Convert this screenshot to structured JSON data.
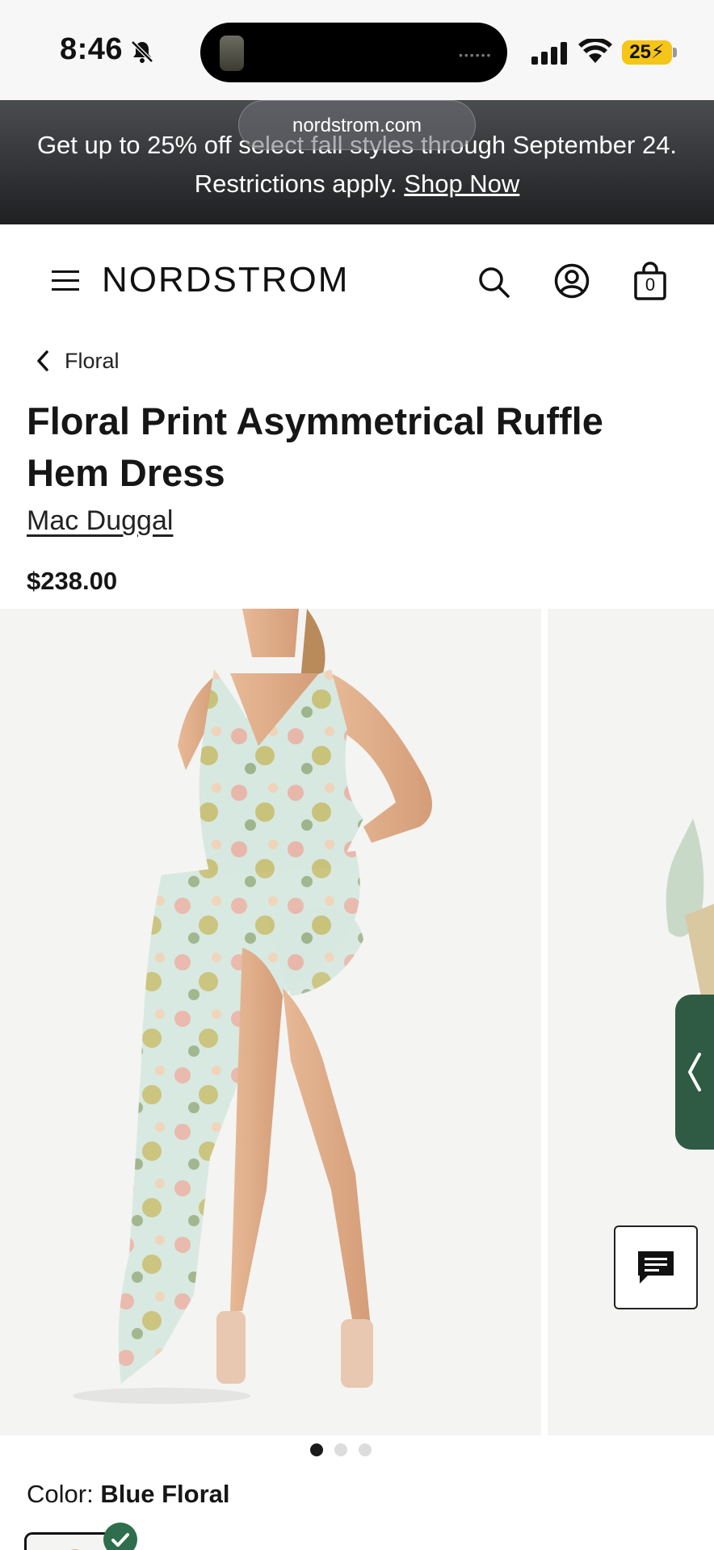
{
  "status_bar": {
    "time": "8:46",
    "battery": "25"
  },
  "browser": {
    "url": "nordstrom.com"
  },
  "promo": {
    "line1": "Get up to 25% off select fall styles through September 24.",
    "line2_prefix": "Restrictions apply.",
    "link": "Shop Now"
  },
  "header": {
    "logo": "NORDSTROM",
    "bag_count": "0"
  },
  "breadcrumb": {
    "label": "Floral"
  },
  "product": {
    "title": "Floral Print Asymmetrical Ruffle Hem Dress",
    "brand": "Mac Duggal",
    "price": "$238.00",
    "color_label": "Color:",
    "color_value": "Blue Floral"
  },
  "gallery": {
    "slide_count": 3,
    "active_index": 0
  },
  "colors": {
    "accent_green": "#2f6e4c",
    "banner_dark": "#1f2022"
  }
}
